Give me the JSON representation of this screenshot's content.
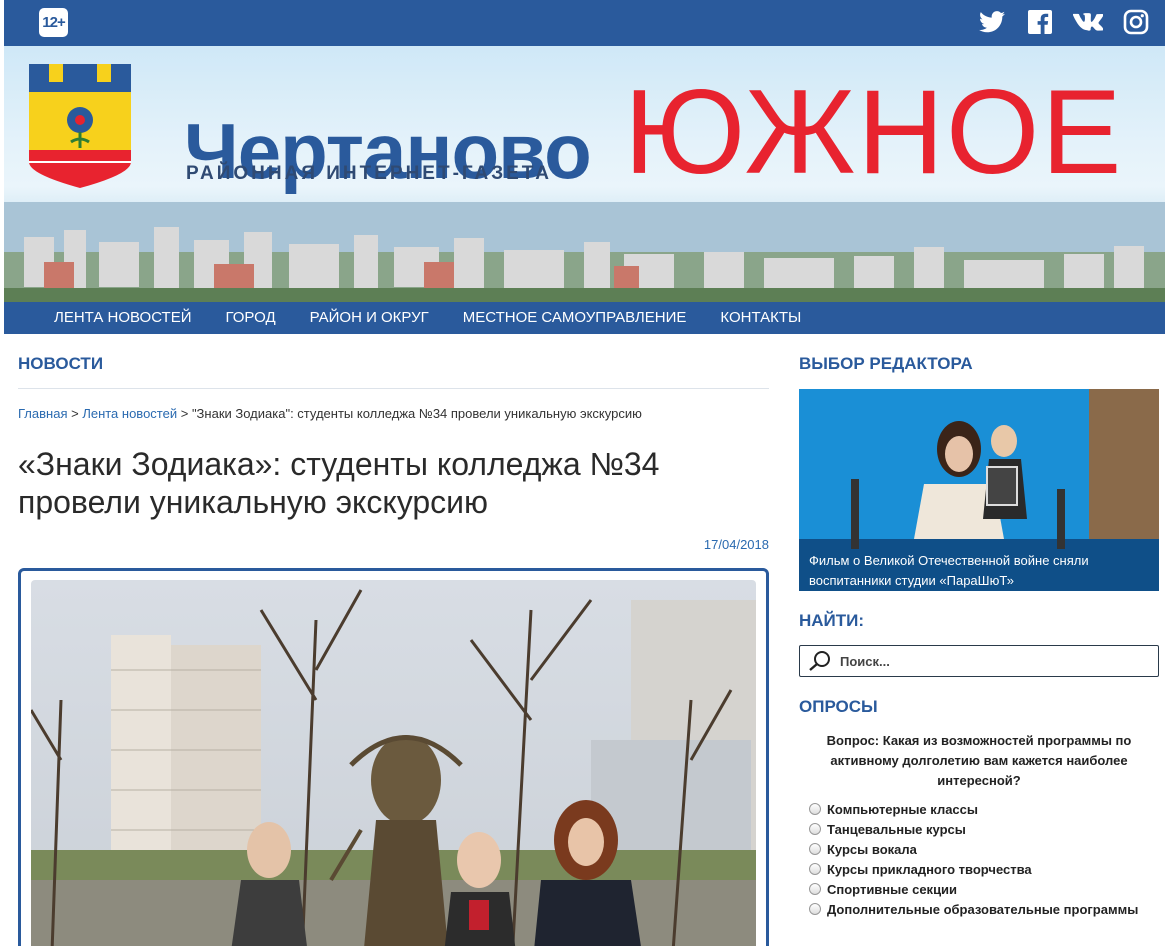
{
  "topbar": {
    "age_rating": "12+"
  },
  "header": {
    "brand_main": "Чертаново",
    "brand_sub": "РАЙОННАЯ ИНТЕРНЕТ-ГАЗЕТА",
    "brand_red": "ЮЖНОЕ"
  },
  "nav": {
    "items": [
      "ЛЕНТА НОВОСТЕЙ",
      "ГОРОД",
      "РАЙОН И ОКРУГ",
      "МЕСТНОЕ САМОУПРАВЛЕНИЕ",
      "КОНТАКТЫ"
    ]
  },
  "main": {
    "section_title": "НОВОСТИ",
    "breadcrumb": {
      "home": "Главная",
      "sep1": " > ",
      "feed": "Лента новостей",
      "sep2": " > ",
      "current": "\"Знаки Зодиака\": студенты колледжа №34 провели уникальную экскурсию"
    },
    "title": "«Знаки Зодиака»: студенты колледжа №34 провели уникальную экскурсию",
    "date": "17/04/2018"
  },
  "sidebar": {
    "editor_title": "ВЫБОР РЕДАКТОРА",
    "editor_caption_line1": "Фильм о Великой Отечественной войне сняли",
    "editor_caption_line2": "воспитанники студии «ПараШюТ»",
    "search_title": "НАЙТИ:",
    "search_placeholder": "Поиск...",
    "polls_title": "ОПРОСЫ",
    "poll_question": "Вопрос: Какая из возможностей программы по активному долголетию вам кажется наиболее интересной?",
    "poll_options": [
      "Компьютерные классы",
      "Танцевальные курсы",
      "Курсы вокала",
      "Курсы прикладного творчества",
      "Спортивные секции",
      "Дополнительные образовательные программы"
    ]
  },
  "colors": {
    "brand_blue": "#2a5a9c",
    "brand_red": "#e8232f",
    "link": "#2a6ab0"
  }
}
